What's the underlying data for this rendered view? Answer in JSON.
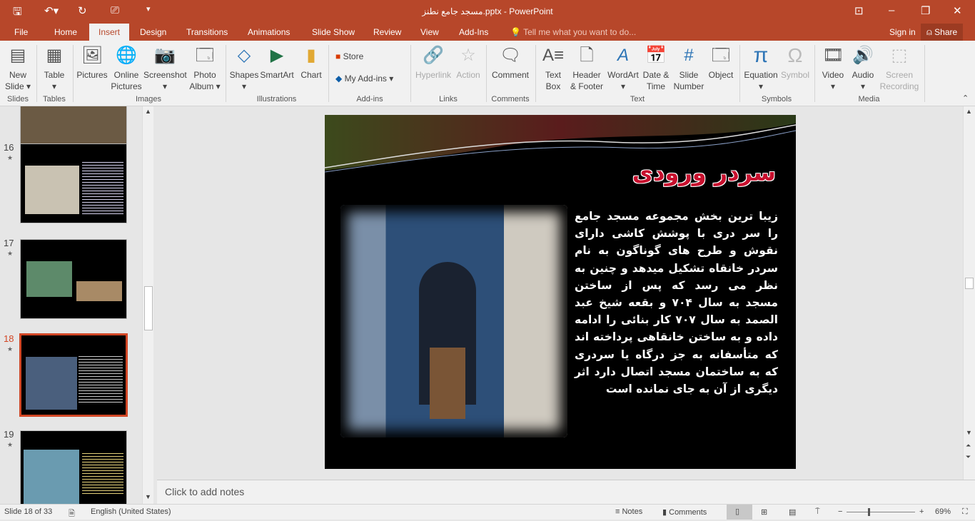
{
  "titlebar": {
    "title": "مسجد جامع نطنز.pptx - PowerPoint",
    "icons": [
      "save-icon",
      "undo-icon",
      "redo-icon",
      "present-icon",
      "customize-icon"
    ]
  },
  "tabs": [
    {
      "label": "File"
    },
    {
      "label": "Home"
    },
    {
      "label": "Insert",
      "active": true
    },
    {
      "label": "Design"
    },
    {
      "label": "Transitions"
    },
    {
      "label": "Animations"
    },
    {
      "label": "Slide Show"
    },
    {
      "label": "Review"
    },
    {
      "label": "View"
    },
    {
      "label": "Add-Ins"
    }
  ],
  "tell_me": "Tell me what you want to do...",
  "sign_in": "Sign in",
  "share": "Share",
  "ribbon": {
    "groups": {
      "slides": "Slides",
      "tables": "Tables",
      "images": "Images",
      "illustrations": "Illustrations",
      "addins": "Add-ins",
      "links": "Links",
      "comments": "Comments",
      "text": "Text",
      "symbols": "Symbols",
      "media": "Media"
    },
    "new_slide": [
      "New",
      "Slide ▾"
    ],
    "table": [
      "Table",
      "▾"
    ],
    "pictures": "Pictures",
    "online_pictures": [
      "Online",
      "Pictures"
    ],
    "screenshot": [
      "Screenshot",
      "▾"
    ],
    "photo_album": [
      "Photo",
      "Album ▾"
    ],
    "shapes": [
      "Shapes",
      "▾"
    ],
    "smartart": "SmartArt",
    "chart": "Chart",
    "store": "Store",
    "my_addins": "My Add-ins",
    "hyperlink": "Hyperlink",
    "action": "Action",
    "comment": "Comment",
    "text_box": [
      "Text",
      "Box"
    ],
    "header_footer": [
      "Header",
      "& Footer"
    ],
    "wordart": [
      "WordArt",
      "▾"
    ],
    "date_time": [
      "Date &",
      "Time"
    ],
    "slide_number": [
      "Slide",
      "Number"
    ],
    "object": "Object",
    "equation": [
      "Equation",
      "▾"
    ],
    "symbol": "Symbol",
    "video": [
      "Video",
      "▾"
    ],
    "audio": [
      "Audio",
      "▾"
    ],
    "screen_recording": [
      "Screen",
      "Recording"
    ]
  },
  "thumbnails": [
    {
      "number": "16"
    },
    {
      "number": "17"
    },
    {
      "number": "18",
      "selected": true
    },
    {
      "number": "19"
    }
  ],
  "slide": {
    "title": "سردر ورودی",
    "body": "زیبا ترین بخش مجموعه مسجد جامع را سر دری با پوشش کاشی دارای نقوش و طرح های گوناگون به نام سردر خانقاه تشکیل میدهد و چنین به نظر می رسد که پس از ساختن مسجد به سال ۷۰۴ و بقعه شیخ عبد الصمد به سال ۷۰۷ کار بنائی را ادامه داده و به ساختن خانقاهی پرداخته اند که متأسفانه به جز درگاه یا سردری که به ساختمان مسجد اتصال دارد اثر دیگری از آن به جای نمانده است",
    "title_color": "#c8102e"
  },
  "notes_placeholder": "Click to add notes",
  "status": {
    "slide": "Slide 18 of 33",
    "language": "English (United States)",
    "notes": "Notes",
    "comments": "Comments",
    "zoom": "69%",
    "zoom_percent": 69
  },
  "colors": {
    "accent": "#b7472a"
  }
}
